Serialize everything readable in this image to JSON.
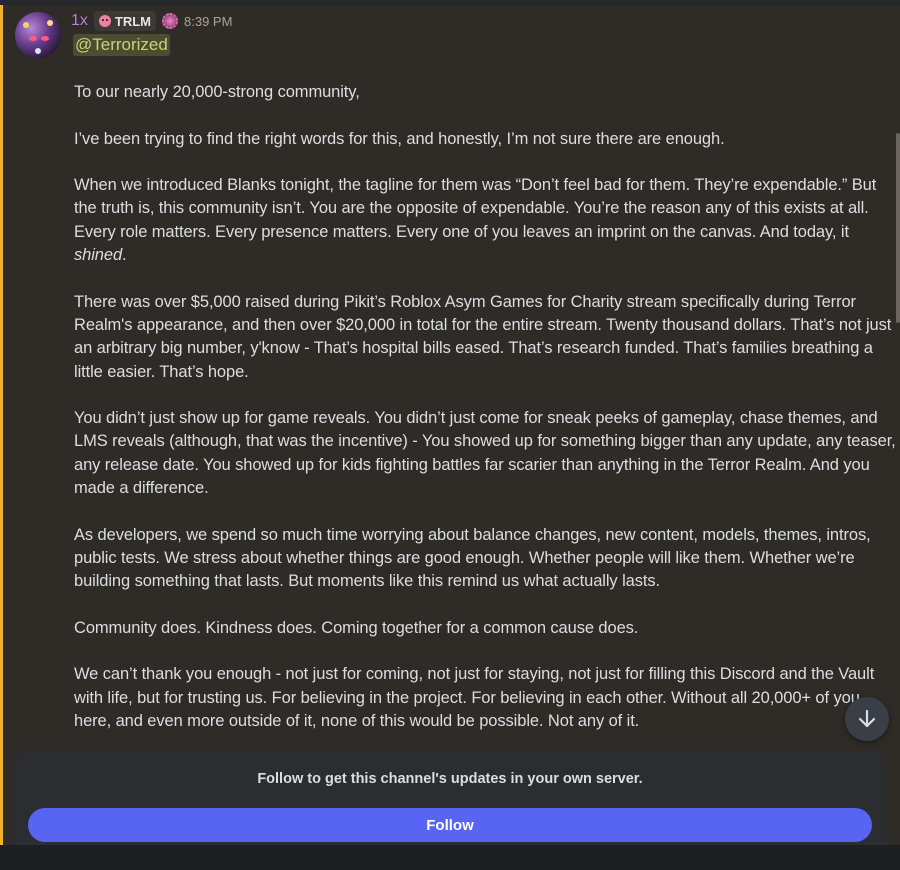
{
  "message": {
    "author_prefix": "1x",
    "tag": "TRLM",
    "timestamp": "8:39 PM",
    "mention": "@Terrorized",
    "paragraphs": [
      "To our nearly 20,000-strong community,",
      "I’ve been trying to find the right words for this, and honestly, I’m not sure there are enough.",
      "When we introduced Blanks tonight, the tagline for them was “Don’t feel bad for them. They’re expendable.” But the truth is, this community isn’t. You are the opposite of expendable. You’re the reason any of this exists at all. Every role matters. Every presence matters. Every one of you leaves an imprint on the canvas. And today, it",
      "There was over $5,000 raised during Pikit’s Roblox Asym Games for Charity stream specifically during Terror Realm's appearance, and then over $20,000 in total for the entire stream. Twenty thousand dollars. That’s not just an arbitrary big number, y'know - That’s hospital bills eased. That’s research funded. That’s families breathing a little easier. That’s hope.",
      "You didn’t just show up for game reveals. You didn’t just come for sneak peeks of gameplay, chase themes, and LMS reveals (although, that was the incentive) - You showed up for something bigger than any update, any teaser, any release date. You showed up for kids fighting battles far scarier than anything in the Terror Realm. And you made a difference.",
      "As developers, we spend so much time worrying about balance changes, new content, models, themes, intros, public tests. We stress about whether things are good enough. Whether people will like them. Whether we’re building something that lasts. But moments like this remind us what actually lasts.",
      "Community does. Kindness does. Coming together for a common cause does.",
      "We can’t thank you enough - not just for coming, not just for staying, not just for filling this Discord and the Vault with life, but for trusting us. For believing in the project. For believing in each other. Without all 20,000+ of you here, and even more outside of it, none of this would be possible. Not any of it."
    ],
    "emphasis_word": "shined",
    "emphasis_tail": "."
  },
  "follow": {
    "prompt": "Follow to get this channel's updates in your own server.",
    "button_label": "Follow"
  },
  "icons": {
    "tag_icon": "skull-icon",
    "role_icon": "flower-badge-icon",
    "jump_icon": "arrow-down-icon"
  },
  "colors": {
    "accent": "#5865f2",
    "highlight_bar": "#f0b232",
    "mention_text": "#c9d27a"
  }
}
